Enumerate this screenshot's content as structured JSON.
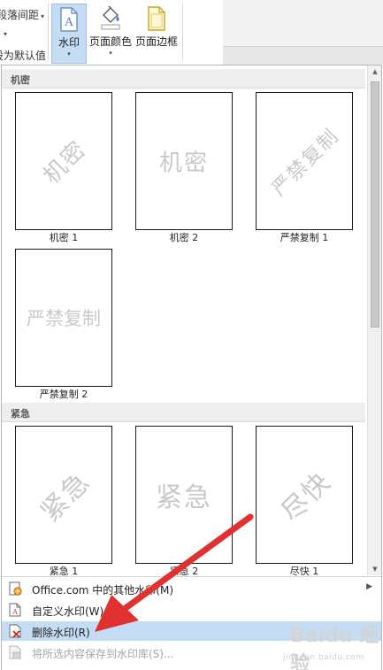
{
  "ribbon": {
    "left_items": [
      "段落间距",
      "",
      "设为默认值"
    ],
    "left_arrow": "▾",
    "watermark_button": "水印",
    "page_color_button": "页面颜色",
    "page_border_button": "页面边框",
    "dropdown_arrow": "▾"
  },
  "gallery": {
    "sections": [
      {
        "header": "机密",
        "tiles": [
          {
            "caption": "机密 1",
            "watermark": "机密",
            "style": "diagonal"
          },
          {
            "caption": "机密 2",
            "watermark": "机密",
            "style": "horizontal"
          },
          {
            "caption": "严禁复制 1",
            "watermark": "严禁复制",
            "style": "diagonal"
          },
          {
            "caption": "严禁复制 2",
            "watermark": "严禁复制",
            "style": "horizontal"
          }
        ]
      },
      {
        "header": "紧急",
        "tiles": [
          {
            "caption": "紧急 1",
            "watermark": "紧急",
            "style": "diagonal"
          },
          {
            "caption": "紧急 2",
            "watermark": "紧急",
            "style": "horizontal"
          },
          {
            "caption": "尽快 1",
            "watermark": "尽快",
            "style": "diagonal"
          }
        ]
      }
    ]
  },
  "menu": {
    "items": [
      {
        "label": "Office.com 中的其他水印(M)",
        "icon": "office-watermark-icon",
        "has_submenu": true
      },
      {
        "label": "自定义水印(W)...",
        "icon": "custom-watermark-icon"
      },
      {
        "label": "删除水印(R)",
        "icon": "remove-watermark-icon",
        "highlighted": true
      },
      {
        "label": "将所选内容保存到水印库(S)...",
        "icon": "save-to-gallery-icon",
        "disabled": true
      }
    ],
    "submenu_arrow": "▶"
  },
  "logo": {
    "text": "Baidu 经验",
    "sub": "jingyan.baidu.com"
  },
  "colors": {
    "highlight": "#c5dcf5",
    "annotation_arrow": "#e03030",
    "watermark_text": "#c9c9c9"
  }
}
